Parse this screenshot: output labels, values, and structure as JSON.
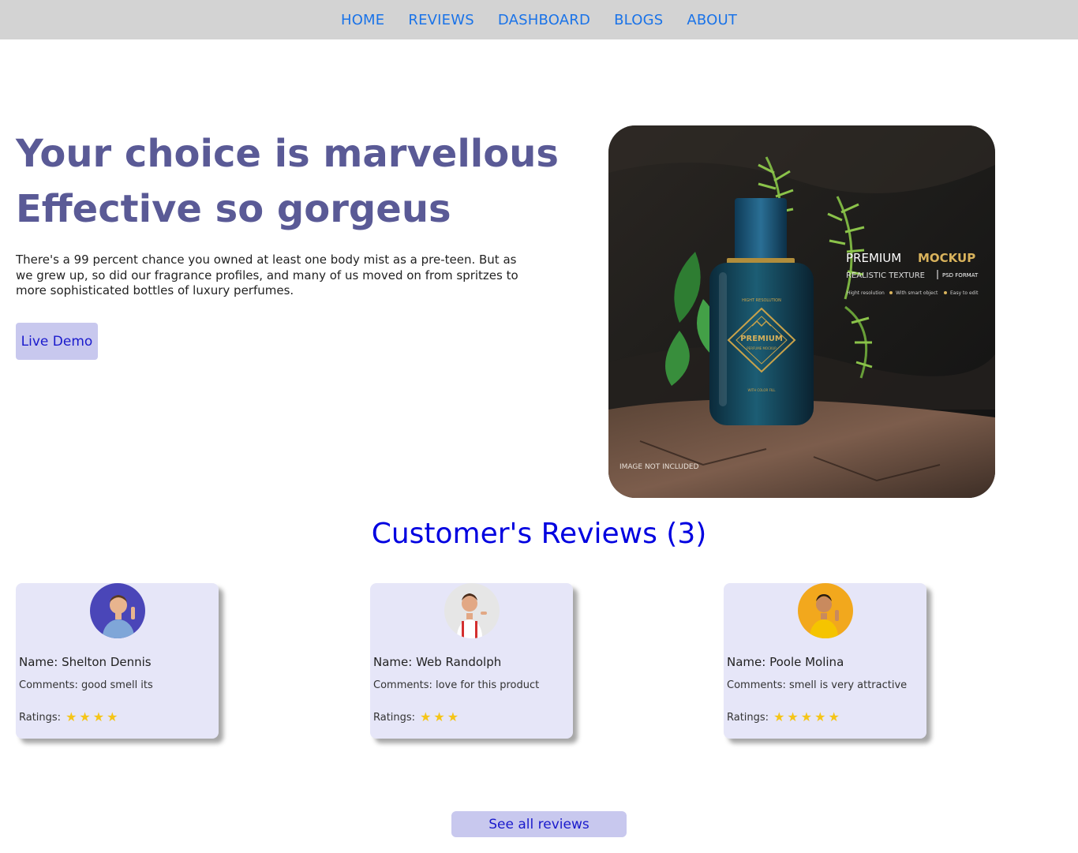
{
  "nav": {
    "items": [
      "HOME",
      "REVIEWS",
      "DASHBOARD",
      "BLOGS",
      "ABOUT"
    ],
    "link_color": "#1a73e8",
    "background": "#d3d3d3"
  },
  "hero": {
    "title_line1": "Your choice is marvellous",
    "title_line2": "Effective so gorgeus",
    "description": "There's a 99 percent chance you owned at least one body mist as a pre-teen. But as we grew up, so did our fragrance profiles, and many of us moved on from spritzes to more sophisticated bottles of luxury perfumes.",
    "button_label": "Live Demo",
    "title_color": "#5a5a96"
  },
  "product_image": {
    "heading_left": "PREMIUM",
    "heading_right": "MOCKUP",
    "subheading": "REALISTIC TEXTURE",
    "format": "PSD FORMAT",
    "features": [
      "Hight resolution",
      "With smart object",
      "Easy to edit"
    ],
    "bottle_top": "HIGHT RESOLUTION",
    "bottle_label": "PREMIUM",
    "bottle_sub": "PERFUME MOCKUP",
    "bottle_bottom": "WITH COLOR FILL",
    "note": "IMAGE NOT INCLUDED"
  },
  "reviews": {
    "title": "Customer's Reviews (3)",
    "title_color": "#0000e0",
    "ratings_label": "Ratings:",
    "star_color": "#f5c518",
    "items": [
      {
        "name": "Name: Shelton Dennis",
        "comment": "Comments: good smell its",
        "rating": 4,
        "avatar_bg": "#4a46b8",
        "avatar_icon": "man-avatar-icon"
      },
      {
        "name": "Name: Web Randolph",
        "comment": "Comments: love for this product",
        "rating": 3,
        "avatar_bg": "#e6e6e6",
        "avatar_icon": "man-avatar-icon"
      },
      {
        "name": "Name: Poole Molina",
        "comment": "Comments: smell is very attractive",
        "rating": 5,
        "avatar_bg": "#f2a81d",
        "avatar_icon": "man-avatar-icon"
      }
    ],
    "see_all_label": "See all reviews"
  }
}
